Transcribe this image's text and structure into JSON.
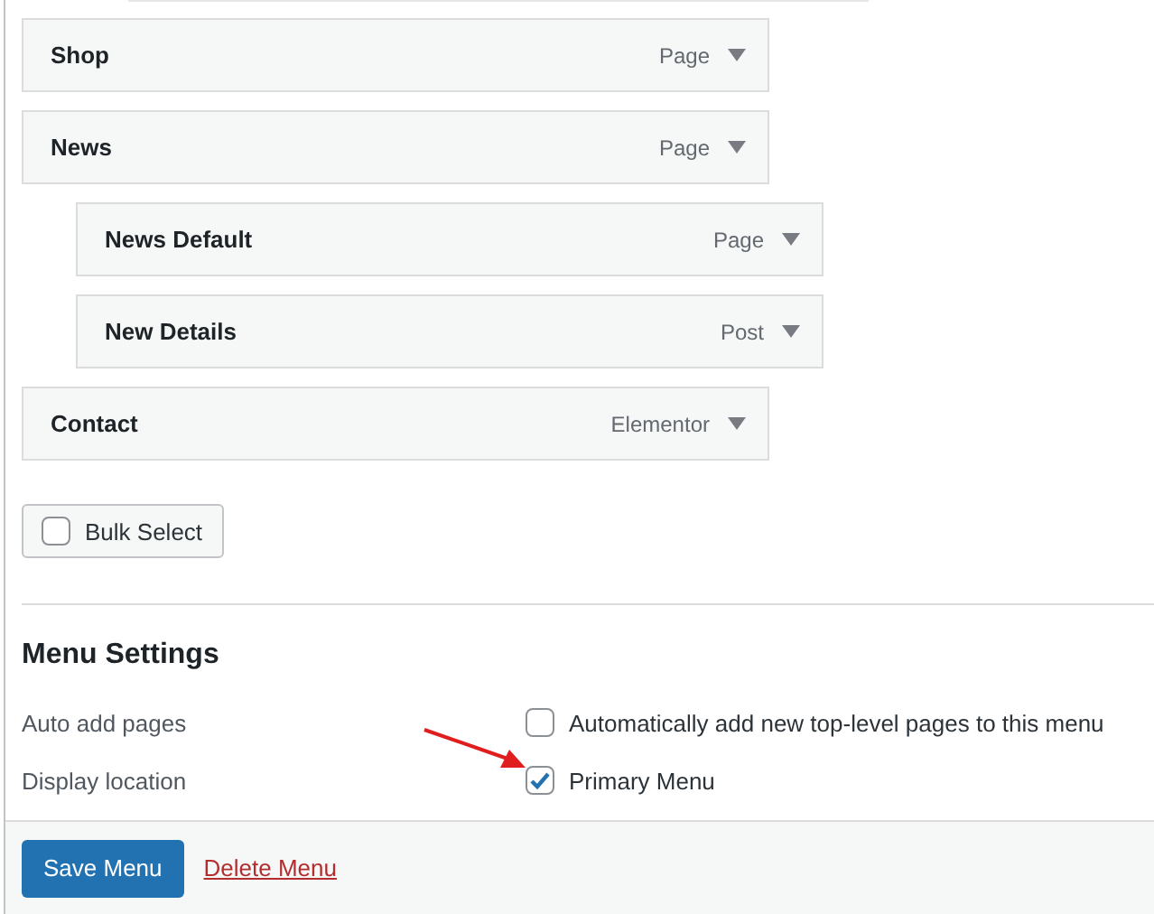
{
  "menu_items": [
    {
      "title": "Shop",
      "type": "Page"
    },
    {
      "title": "News",
      "type": "Page",
      "children": [
        {
          "title": "News Default",
          "type": "Page"
        },
        {
          "title": "New Details",
          "type": "Post"
        }
      ]
    },
    {
      "title": "Contact",
      "type": "Elementor"
    }
  ],
  "bulk_select": {
    "label": "Bulk Select",
    "checked": false
  },
  "menu_settings": {
    "heading": "Menu Settings",
    "rows": [
      {
        "label": "Auto add pages",
        "option": "Automatically add new top-level pages to this menu",
        "checked": false
      },
      {
        "label": "Display location",
        "option": "Primary Menu",
        "checked": true
      }
    ]
  },
  "footer": {
    "save": "Save Menu",
    "delete": "Delete Menu"
  }
}
